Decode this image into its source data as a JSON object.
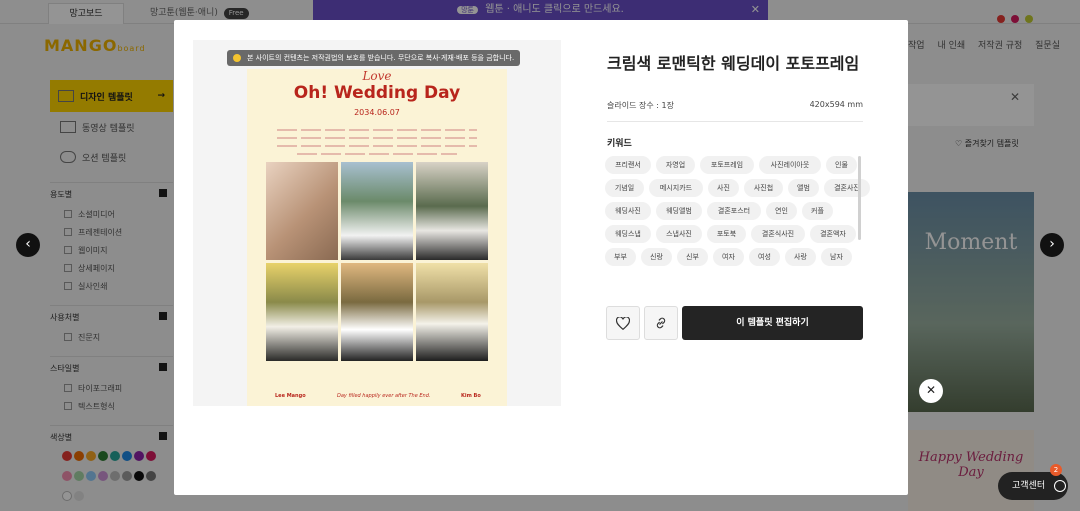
{
  "topbar": {
    "tab_active": "망고보드",
    "tab_secondary": "망고툰(웹툰·애니)",
    "free_badge": "Free",
    "promo_badge": "망툰",
    "promo_text": "웹툰 · 애니도 클릭으로 만드세요.",
    "promo_close": "✕",
    "window_dots": [
      "#e53935",
      "#d81b60",
      "#c0ca33"
    ]
  },
  "brand": {
    "logo": "MANGO",
    "logo_sub": "board"
  },
  "nav": {
    "items": [
      "작업",
      "내 인쇄",
      "저작권 규정",
      "질문실"
    ]
  },
  "sidebar": {
    "main": "디자인 템플릿",
    "items": [
      "동영상 템플릿",
      "오션 템플릿"
    ],
    "sections": [
      {
        "title": "용도별",
        "checks": [
          "소셜미디어",
          "프레젠테이션",
          "웹이미지",
          "상세페이지",
          "실사인쇄"
        ]
      },
      {
        "title": "사용처별",
        "checks": [
          "진문지"
        ]
      },
      {
        "title": "스타일별",
        "checks": [
          "타이포그래피",
          "텍스트형식"
        ]
      },
      {
        "title": "색상별",
        "checks": []
      }
    ],
    "colors": [
      "#e53935",
      "#ef6c00",
      "#f9a825",
      "#2e7d32",
      "#26a69a",
      "#1e88e5",
      "#8e24aa",
      "#d81b60",
      "#f48fb1",
      "#a5d6a7",
      "#90caf9",
      "#ce93d8",
      "#bdbdbd",
      "#9e9e9e",
      "#111111",
      "#757575",
      "#ffffff",
      "#e0e0e0"
    ]
  },
  "background": {
    "favorite_label": "즐겨찾기 템플릿",
    "card1_title": "Moment",
    "card2_title": "Happy Wedding Day",
    "help_label": "고객센터",
    "help_badge": "2",
    "close_x": "✕"
  },
  "modal": {
    "notice": "본 사이트의 컨텐츠는 저작권법의 보호를 받습니다. 무단으로 복사·게재·배포 등을 금합니다.",
    "poster": {
      "script": "Love",
      "title": "Oh! Wedding Day",
      "date": "2034.06.07",
      "foot_left": "Lee Mango",
      "foot_center": "Day filled happily ever after The End.",
      "foot_right": "Kim Bo"
    },
    "title": "크림색 로맨틱한 웨딩데이 포토프레임",
    "slides_label": "슬라이드 장수 : 1장",
    "size_label": "420x594 mm",
    "keywords_label": "키워드",
    "keywords": [
      [
        "프리랜서",
        "자영업",
        "포토프레임",
        "사진레이아웃",
        "인물"
      ],
      [
        "기념일",
        "메시지카드",
        "사진",
        "사진첩",
        "앨범",
        "결혼사진"
      ],
      [
        "웨딩사진",
        "웨딩앨범",
        "결혼포스터",
        "연인",
        "커플"
      ],
      [
        "웨딩스냅",
        "스냅사진",
        "포토북",
        "결혼식사진",
        "결혼액자"
      ],
      [
        "부부",
        "신랑",
        "신부",
        "여자",
        "여성",
        "사랑",
        "남자"
      ]
    ],
    "edit_button": "이 템플릿 편집하기",
    "close_icon": "✕"
  },
  "icons": {
    "prev": "‹",
    "next": "›"
  }
}
